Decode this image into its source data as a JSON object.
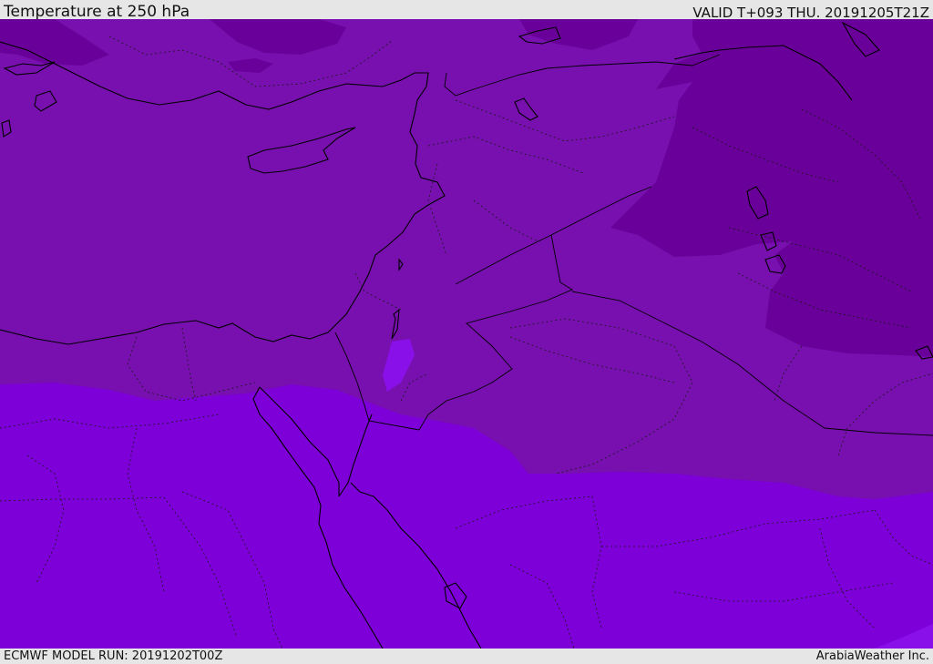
{
  "header": {
    "title": "Temperature at 250 hPa",
    "valid_time": "VALID T+093 THU. 20191205T21Z"
  },
  "footer": {
    "model_run": "ECMWF MODEL RUN: 20191202T00Z",
    "credit": "ArabiaWeather Inc."
  },
  "map": {
    "colors": {
      "band_cold": "#6a009a",
      "band_mid": "#7710ae",
      "band_warm": "#7d00d8",
      "band_warmer": "#8a10ea",
      "coast": "#000000",
      "border": "#202020"
    }
  }
}
